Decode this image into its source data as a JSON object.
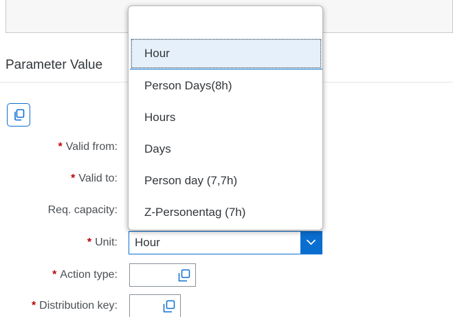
{
  "section": {
    "title": "Parameter Value"
  },
  "form": {
    "valid_from_label": "Valid from:",
    "valid_to_label": "Valid to:",
    "req_capacity_label": "Req. capacity:",
    "unit_label": "Unit:",
    "unit_value": "Hour",
    "action_type_label": "Action type:",
    "distribution_key_label": "Distribution key:",
    "required_marker": "*"
  },
  "unit_dropdown": {
    "items": [
      "Hour",
      "Person Days(8h)",
      "Hours",
      "Days",
      "Person day (7,7h)",
      "Z-Personentag (7h)"
    ],
    "selected": "Hour"
  },
  "colors": {
    "accent": "#0a6ed1",
    "required": "#bb0000",
    "selected_bg": "#e5f0fa"
  },
  "icons": {
    "copy": "copy-icon",
    "dropdown": "chevron-down-icon",
    "value_help": "value-help-icon"
  }
}
